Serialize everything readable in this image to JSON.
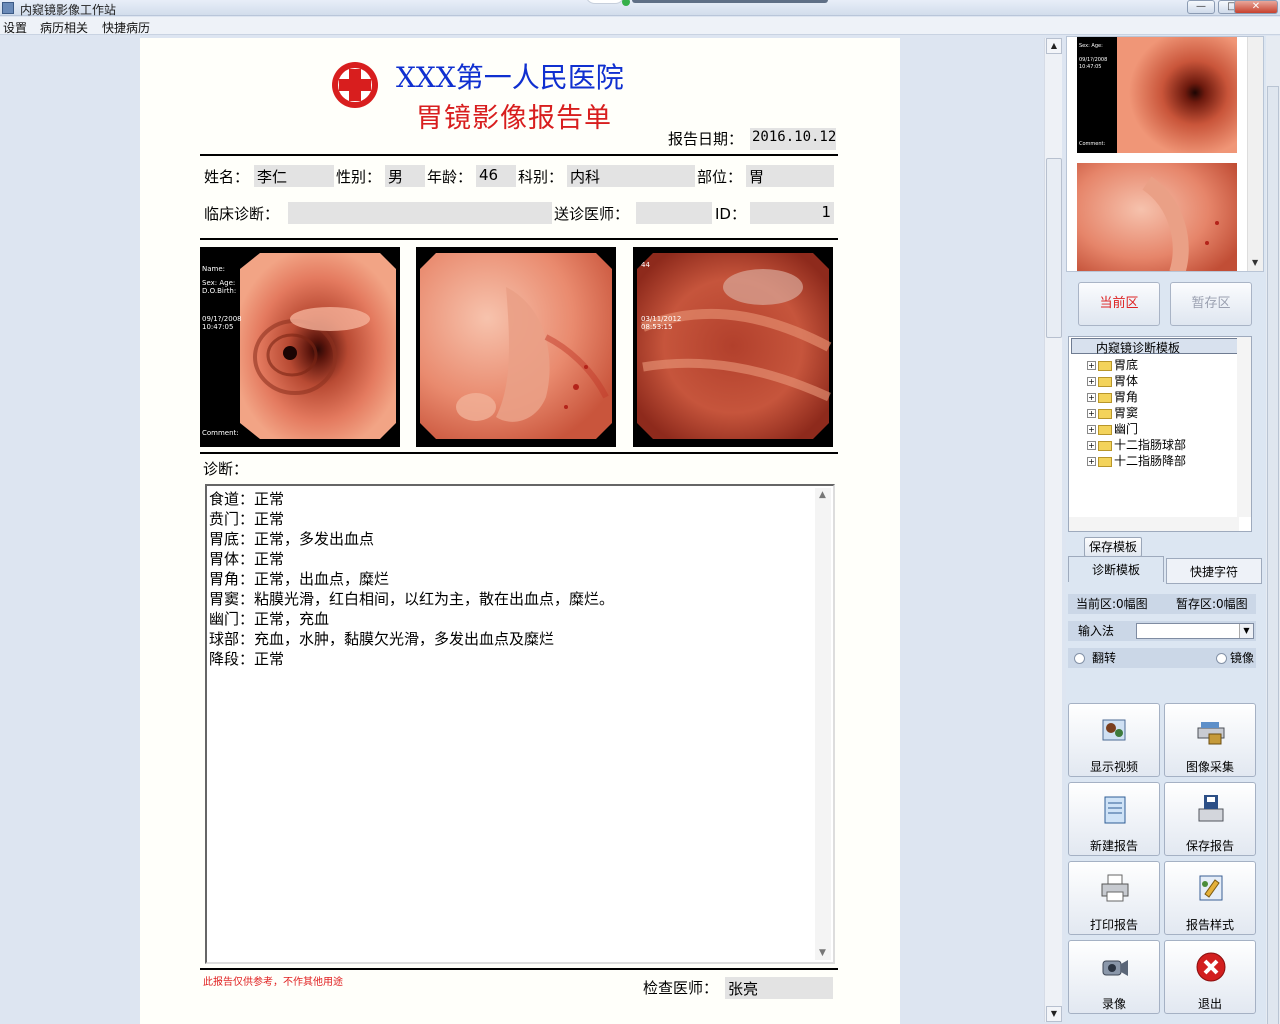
{
  "window": {
    "title": "内窥镜影像工作站",
    "min": "—",
    "max": "□",
    "close": "✕"
  },
  "menu": [
    "设置",
    "病历相关",
    "快捷病历"
  ],
  "report": {
    "hospital": "XXX第一人民医院",
    "title": "胃镜影像报告单",
    "date_label": "报告日期：",
    "date": "2016.10.12",
    "name_label": "姓名：",
    "name": "李仁",
    "gender_label": "性别：",
    "gender": "男",
    "age_label": "年龄：",
    "age": "46",
    "dept_label": "科别：",
    "dept": "内科",
    "site_label": "部位：",
    "site": "胃",
    "clinical_label": "临床诊断：",
    "clinical": "",
    "referrer_label": "送诊医师：",
    "referrer": "",
    "id_label": "ID：",
    "id": "1",
    "diag_label": "诊断：",
    "diagnosis": [
      "食道：正常",
      "贲门：正常",
      "胃底：正常，多发出血点",
      "胃体：正常",
      "胃角：正常，出血点，糜烂",
      "胃窦：粘膜光滑，红白相间，以红为主，散在出血点，糜烂。",
      "幽门：正常，充血",
      "球部：充血，水肿，黏膜欠光滑，多发出血点及糜烂",
      "降段：正常"
    ],
    "disclaimer": "此报告仅供参考，不作其他用途",
    "doctor_label": "检查医师：",
    "doctor": "张亮",
    "images": [
      {
        "overlay": [
          "Name:",
          "Sex: Age:",
          "D.O.Birth:",
          "09/1?/2008",
          "10:47:05",
          "Comment:"
        ]
      },
      {
        "overlay": []
      },
      {
        "overlay": [
          "44",
          "03/11/2012",
          "08:53:15"
        ]
      }
    ]
  },
  "right_panel": {
    "current_zone": "当前区",
    "temp_zone": "暂存区",
    "tree_title": "内窥镜诊断模板",
    "tree_items": [
      "胃底",
      "胃体",
      "胃角",
      "胃窦",
      "幽门",
      "十二指肠球部",
      "十二指肠降部"
    ],
    "save_template": "保存模板",
    "tabs": [
      "诊断模板",
      "快捷字符"
    ],
    "status_current": "当前区:0幅图",
    "status_temp": "暂存区:0幅图",
    "ime_label": "输入法",
    "flip_label": "翻转",
    "mirror_label": "镜像",
    "buttons": [
      "显示视频",
      "图像采集",
      "新建报告",
      "保存报告",
      "打印报告",
      "报告样式",
      "录像",
      "退出"
    ],
    "icons": [
      "video-icon",
      "scanner-icon",
      "notepad-icon",
      "floppy-save-icon",
      "printer-icon",
      "report-style-icon",
      "camcorder-icon",
      "exit-icon"
    ]
  },
  "colors": {
    "hospital": "#1030d0",
    "title": "#d81e1e",
    "page": "#fffffa",
    "panel": "#dce6f2"
  }
}
